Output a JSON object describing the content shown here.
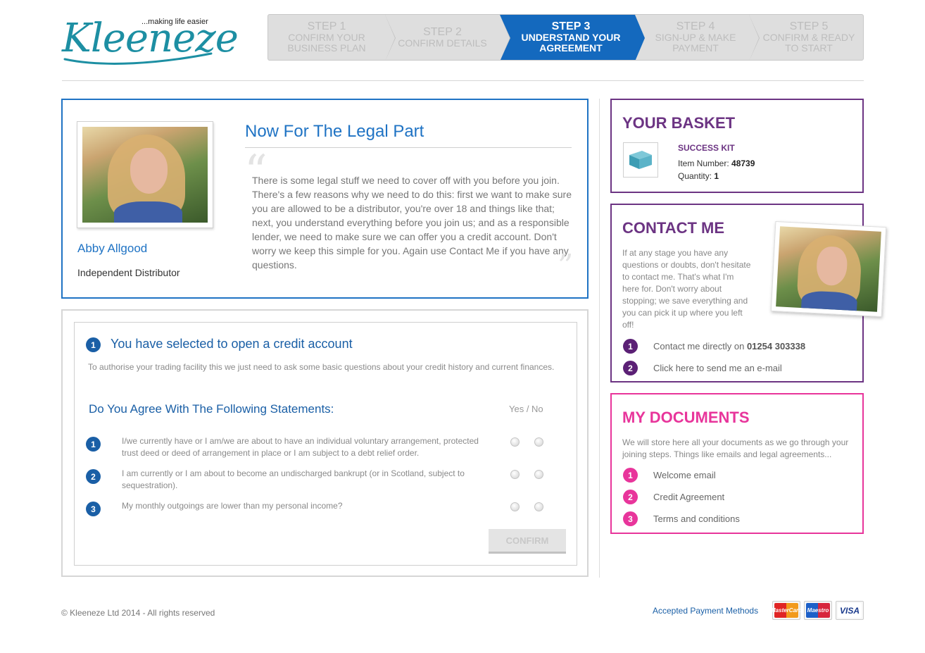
{
  "brand": {
    "name": "Kleeneze",
    "tagline": "...making life easier",
    "colors": {
      "teal": "#1d8fa3",
      "blue": "#1f73c4",
      "purple": "#6c3483",
      "pink": "#e8359b"
    }
  },
  "steps": [
    {
      "num": "STEP 1",
      "label_line1": "CONFIRM YOUR",
      "label_line2": "BUSINESS PLAN",
      "active": false
    },
    {
      "num": "STEP 2",
      "label_line1": "CONFIRM DETAILS",
      "label_line2": "",
      "active": false
    },
    {
      "num": "STEP 3",
      "label_line1": "UNDERSTAND YOUR",
      "label_line2": "AGREEMENT",
      "active": true
    },
    {
      "num": "STEP 4",
      "label_line1": "SIGN-UP & MAKE",
      "label_line2": "PAYMENT",
      "active": false
    },
    {
      "num": "STEP 5",
      "label_line1": "CONFIRM & READY",
      "label_line2": "TO START",
      "active": false
    }
  ],
  "intro": {
    "name": "Abby Allgood",
    "role": "Independent Distributor",
    "title": "Now For The Legal Part",
    "text": "There is some legal stuff we need to cover off with you before you join. There's a few reasons why we need to do this: first we want to make sure you are allowed to be a distributor, you're over 18 and things like that; next, you understand everything before you join us; and as a responsible lender, we need to make sure we can offer you a credit account. Don't worry we keep this simple for you. Again use Contact Me if you have any questions.",
    "quote_open": "“",
    "quote_close": "”"
  },
  "credit": {
    "badge": "1",
    "title": "You have selected to open a credit account",
    "description": "To authorise your trading facility this we just need to ask some basic questions about your credit history and current finances.",
    "agree_title": "Do You Agree With The Following Statements:",
    "yes_no_label": "Yes / No",
    "statements": [
      {
        "num": "1",
        "text": "I/we currently have or I am/we are about to have an individual voluntary arrangement, protected trust deed or deed of arrangement in place or I am subject to a debt relief order."
      },
      {
        "num": "2",
        "text": "I am currently or I am about to become an undischarged bankrupt (or in Scotland, subject to sequestration)."
      },
      {
        "num": "3",
        "text": "My monthly outgoings are lower than my personal income?"
      }
    ],
    "confirm_label": "CONFIRM"
  },
  "basket": {
    "title": "YOUR BASKET",
    "item_name": "SUCCESS KIT",
    "item_number_label": "Item Number:",
    "item_number": "48739",
    "quantity_label": "Quantity:",
    "quantity": "1"
  },
  "contact": {
    "title": "CONTACT ME",
    "description": "If at any stage you have any questions or doubts, don't hesitate to contact me. That's what I'm here for. Don't worry about stopping; we save everything and you can pick it up where you left off!",
    "items": [
      {
        "num": "1",
        "label": "Contact me directly on ",
        "phone": "01254 303338"
      },
      {
        "num": "2",
        "label": "Click here to send me an e-mail",
        "phone": ""
      }
    ]
  },
  "documents": {
    "title": "MY DOCUMENTS",
    "description": "We will store here all your documents as we go through your joining steps. Things like emails and legal agreements...",
    "items": [
      {
        "num": "1",
        "label": "Welcome email"
      },
      {
        "num": "2",
        "label": "Credit Agreement"
      },
      {
        "num": "3",
        "label": "Terms and conditions"
      }
    ]
  },
  "footer": {
    "copyright": "© Kleeneze Ltd 2014 - All rights reserved",
    "payment_label": "Accepted Payment Methods",
    "cards": [
      "MasterCard",
      "Maestro",
      "VISA"
    ]
  }
}
